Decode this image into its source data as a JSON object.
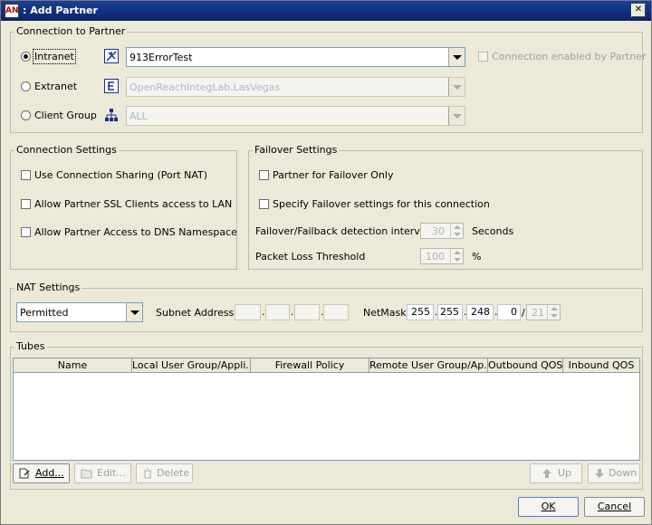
{
  "window": {
    "title": ": Add Partner",
    "close_glyph": "✕",
    "app_icon_text": "AN"
  },
  "connection": {
    "legend": "Connection to Partner",
    "intranet": {
      "label": "Intranet",
      "value": "913ErrorTest",
      "selected": true,
      "icon": "intranet-icon"
    },
    "extranet": {
      "label": "Extranet",
      "value": "OpenReachIntegLab.LasVegas",
      "selected": false,
      "icon": "extranet-icon"
    },
    "client_group": {
      "label": "Client Group",
      "value": "ALL",
      "selected": false,
      "icon": "client-group-icon"
    },
    "enabled_by_partner": "Connection enabled by Partner"
  },
  "connection_settings": {
    "legend": "Connection Settings",
    "items": [
      "Use Connection Sharing (Port NAT)",
      "Allow Partner SSL Clients access to LAN",
      "Allow Partner Access to DNS Namespace"
    ]
  },
  "failover": {
    "legend": "Failover Settings",
    "failover_only": "Partner for Failover Only",
    "specify": "Specify Failover settings for this connection",
    "interval_label": "Failover/Failback detection interval",
    "interval_value": "30",
    "interval_unit": "Seconds",
    "loss_label": "Packet Loss Threshold",
    "loss_value": "100",
    "loss_unit": "%"
  },
  "nat": {
    "legend": "NAT Settings",
    "mode": "Permitted",
    "subnet_label": "Subnet Address",
    "subnet": [
      "",
      "",
      "",
      ""
    ],
    "netmask_label": "NetMask",
    "netmask": [
      "255",
      "255",
      "248",
      "0"
    ],
    "prefix": "21",
    "slash": "/"
  },
  "tubes": {
    "legend": "Tubes",
    "columns": [
      "Name",
      "Local User Group/Appli...",
      "Firewall Policy",
      "Remote User Group/Ap...",
      "Outbound QOS",
      "Inbound QOS"
    ],
    "add": "Add...",
    "edit": "Edit...",
    "delete": "Delete",
    "up": "Up",
    "down": "Down"
  },
  "dialog": {
    "ok": "OK",
    "cancel": "Cancel"
  },
  "colors": {
    "title_bar": "#0a246a",
    "window_bg": "#ece9d8",
    "field_border": "#7f9db9"
  }
}
